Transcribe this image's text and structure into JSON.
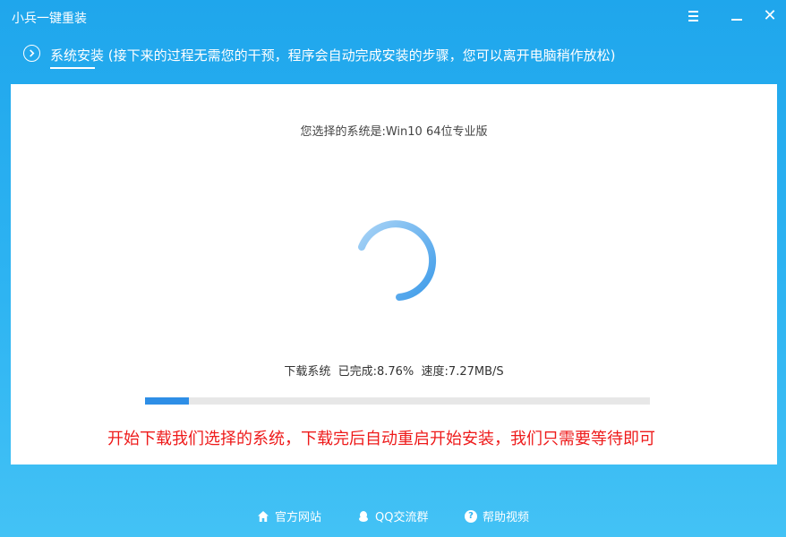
{
  "window": {
    "title": "小兵一键重装",
    "menu_icon": "menu-icon",
    "minimize_icon": "minimize-icon",
    "close_icon": "close-icon",
    "close_glyph": "✕"
  },
  "step": {
    "icon": "chevron-right-circle-icon",
    "text": "系统安装 (接下来的过程无需您的干预，程序会自动完成安装的步骤，您可以离开电脑稍作放松)"
  },
  "main": {
    "selected_system": "您选择的系统是:Win10 64位专业版",
    "spinner_icon": "loading-spinner-icon",
    "progress_text": "下载系统  已完成:8.76%  速度:7.27MB/S",
    "progress_fraction": 0.0876,
    "notice": "开始下载我们选择的系统，下载完后自动重启开始安装，我们只需要等待即可"
  },
  "footer": {
    "links": [
      {
        "label": "官方网站",
        "icon": "home-icon"
      },
      {
        "label": "QQ交流群",
        "icon": "qq-penguin-icon"
      },
      {
        "label": "帮助视频",
        "icon": "help-icon"
      }
    ]
  },
  "colors": {
    "background_top": "#1fa6ec",
    "background_bottom": "#43c2f5",
    "progress_fill": "#2e8ee6",
    "spinner": "#3d9be9",
    "notice_text": "#ee1b1b"
  }
}
